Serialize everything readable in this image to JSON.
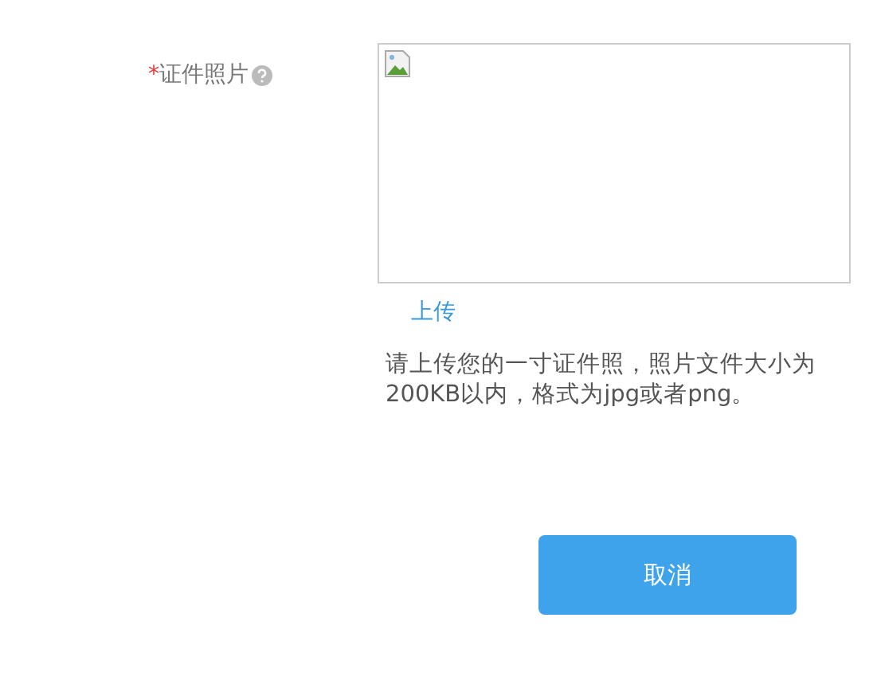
{
  "photo_field": {
    "required_mark": "*",
    "label": "证件照片",
    "upload_link": "上传",
    "hint": "请上传您的一寸证件照，照片文件大小为200KB以内，格式为jpg或者png。"
  },
  "buttons": [
    {
      "label": "取消"
    }
  ]
}
